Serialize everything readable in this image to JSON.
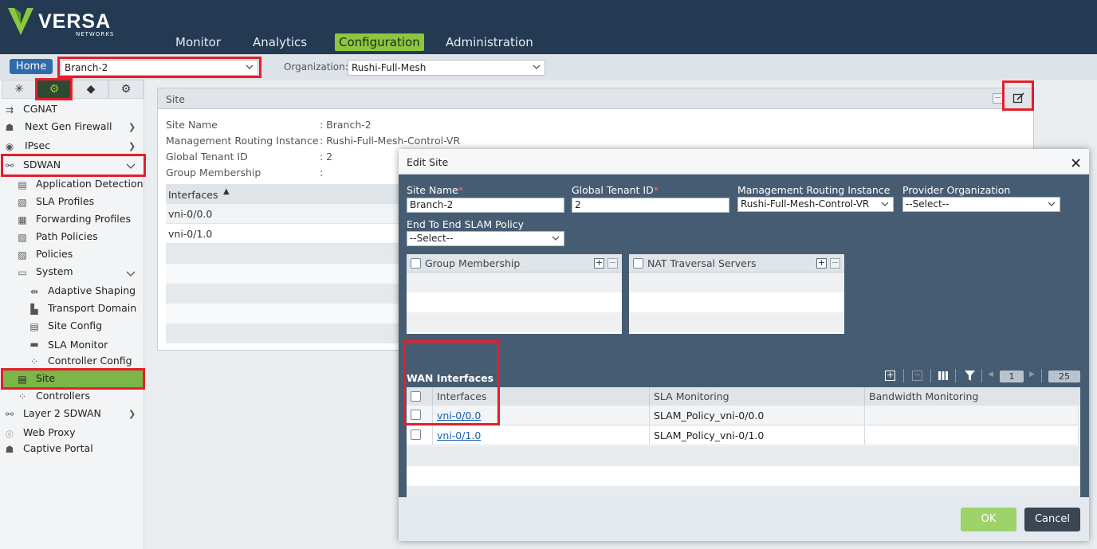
{
  "brand": {
    "name": "VERSA",
    "sub": "NETWORKS"
  },
  "nav": [
    "Monitor",
    "Analytics",
    "Configuration",
    "Administration"
  ],
  "home_label": "Home",
  "appliance_selected": "Branch-2",
  "org_label": "Organization:",
  "org_selected": "Rushi-Full-Mesh",
  "sidebar": {
    "items": [
      {
        "label": "CGNAT"
      },
      {
        "label": "Next Gen Firewall"
      },
      {
        "label": "IPsec"
      },
      {
        "label": "SDWAN"
      },
      {
        "label": "Application Detection"
      },
      {
        "label": "SLA Profiles"
      },
      {
        "label": "Forwarding Profiles"
      },
      {
        "label": "Path Policies"
      },
      {
        "label": "Policies"
      },
      {
        "label": "System"
      },
      {
        "label": "Adaptive Shaping"
      },
      {
        "label": "Transport Domain"
      },
      {
        "label": "Site Config"
      },
      {
        "label": "SLA Monitor"
      },
      {
        "label": "Controller Config"
      },
      {
        "label": "Site"
      },
      {
        "label": "Controllers"
      },
      {
        "label": "Layer 2 SDWAN"
      },
      {
        "label": "Web Proxy"
      },
      {
        "label": "Captive Portal"
      }
    ]
  },
  "site_panel": {
    "title": "Site",
    "fields": [
      {
        "label": "Site Name",
        "value": ": Branch-2"
      },
      {
        "label": "Management Routing Instance",
        "value": ": Rushi-Full-Mesh-Control-VR"
      },
      {
        "label": "Global Tenant ID",
        "value": ": 2"
      },
      {
        "label": "Group Membership",
        "value": ":"
      }
    ],
    "interfaces_header": "Interfaces",
    "interfaces": [
      "vni-0/0.0",
      "vni-0/1.0"
    ]
  },
  "modal": {
    "title": "Edit Site",
    "site_name_label": "Site Name",
    "site_name_value": "Branch-2",
    "tenant_label": "Global Tenant ID",
    "tenant_value": "2",
    "mri_label": "Management Routing Instance",
    "mri_value": "Rushi-Full-Mesh-Control-VR",
    "provider_label": "Provider Organization",
    "provider_value": "--Select--",
    "slam_label": "End To End SLAM Policy",
    "slam_value": "--Select--",
    "group_membership": "Group Membership",
    "nat_servers": "NAT Traversal Servers",
    "wan_title": "WAN Interfaces",
    "page_number": "1",
    "page_size": "25",
    "wan_headers": [
      "Interfaces",
      "SLA Monitoring",
      "Bandwidth Monitoring"
    ],
    "wan_rows": [
      {
        "interface": "vni-0/0.0",
        "sla": "SLAM_Policy_vni-0/0.0",
        "bandwidth": ""
      },
      {
        "interface": "vni-0/1.0",
        "sla": "SLAM_Policy_vni-0/1.0",
        "bandwidth": ""
      }
    ],
    "ok_label": "OK",
    "cancel_label": "Cancel"
  }
}
